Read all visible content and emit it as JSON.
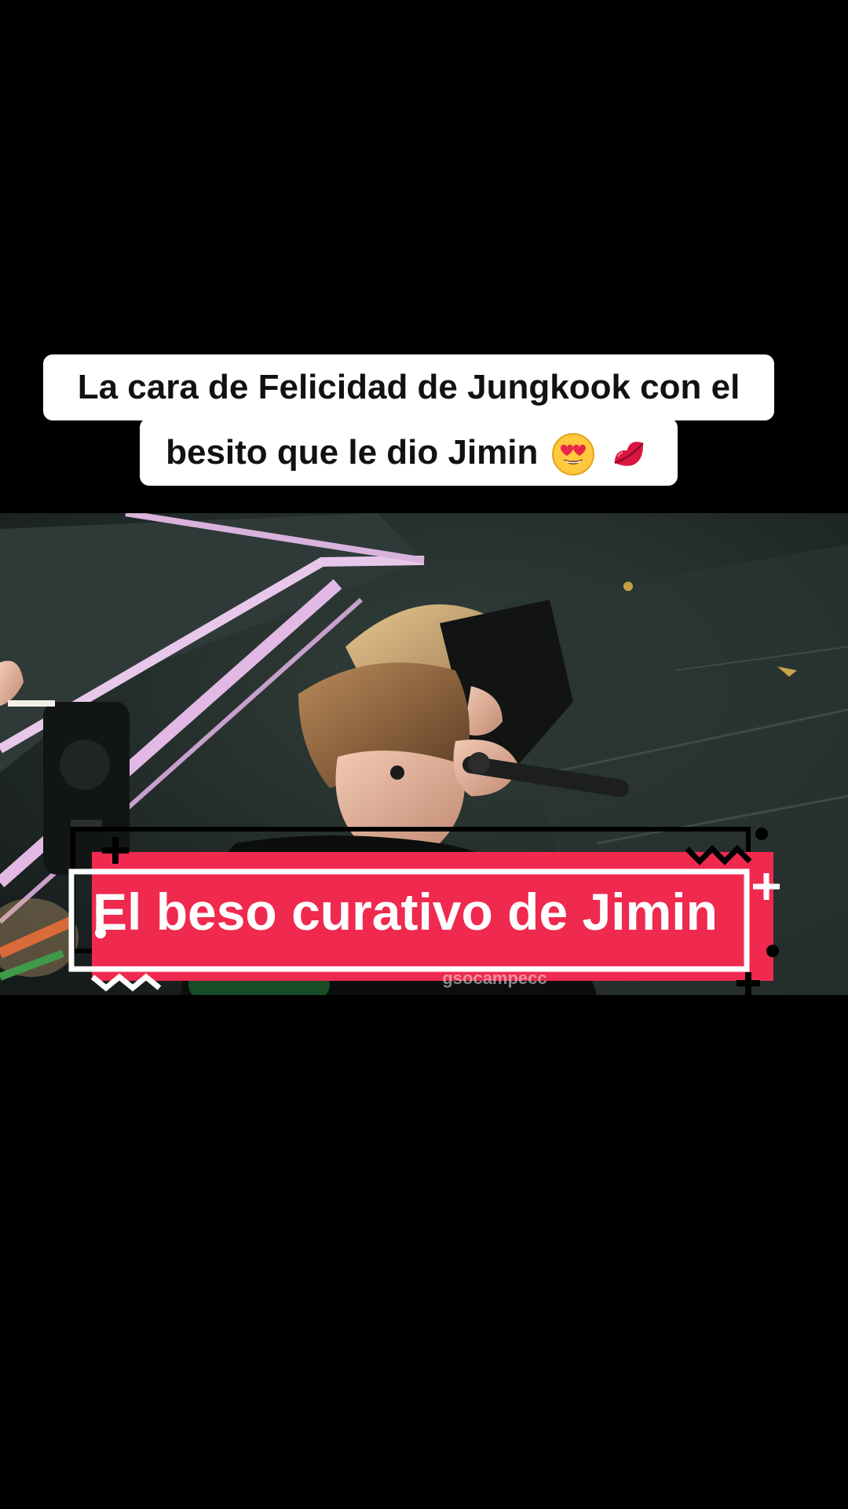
{
  "caption": {
    "line1": "La cara de Felicidad de Jungkook con el",
    "line2": "besito que le dio Jimin",
    "emojis": [
      "heart-eyes-emoji",
      "kiss-mark-emoji"
    ]
  },
  "banner": {
    "text": "El beso curativo de Jimin"
  },
  "video": {
    "watermark": "gsocampecc"
  },
  "colors": {
    "background": "#000000",
    "caption_bg": "#ffffff",
    "caption_text": "#111111",
    "banner_fill": "#f0294f",
    "banner_outline": "#ffffff",
    "banner_decor": "#000000"
  }
}
